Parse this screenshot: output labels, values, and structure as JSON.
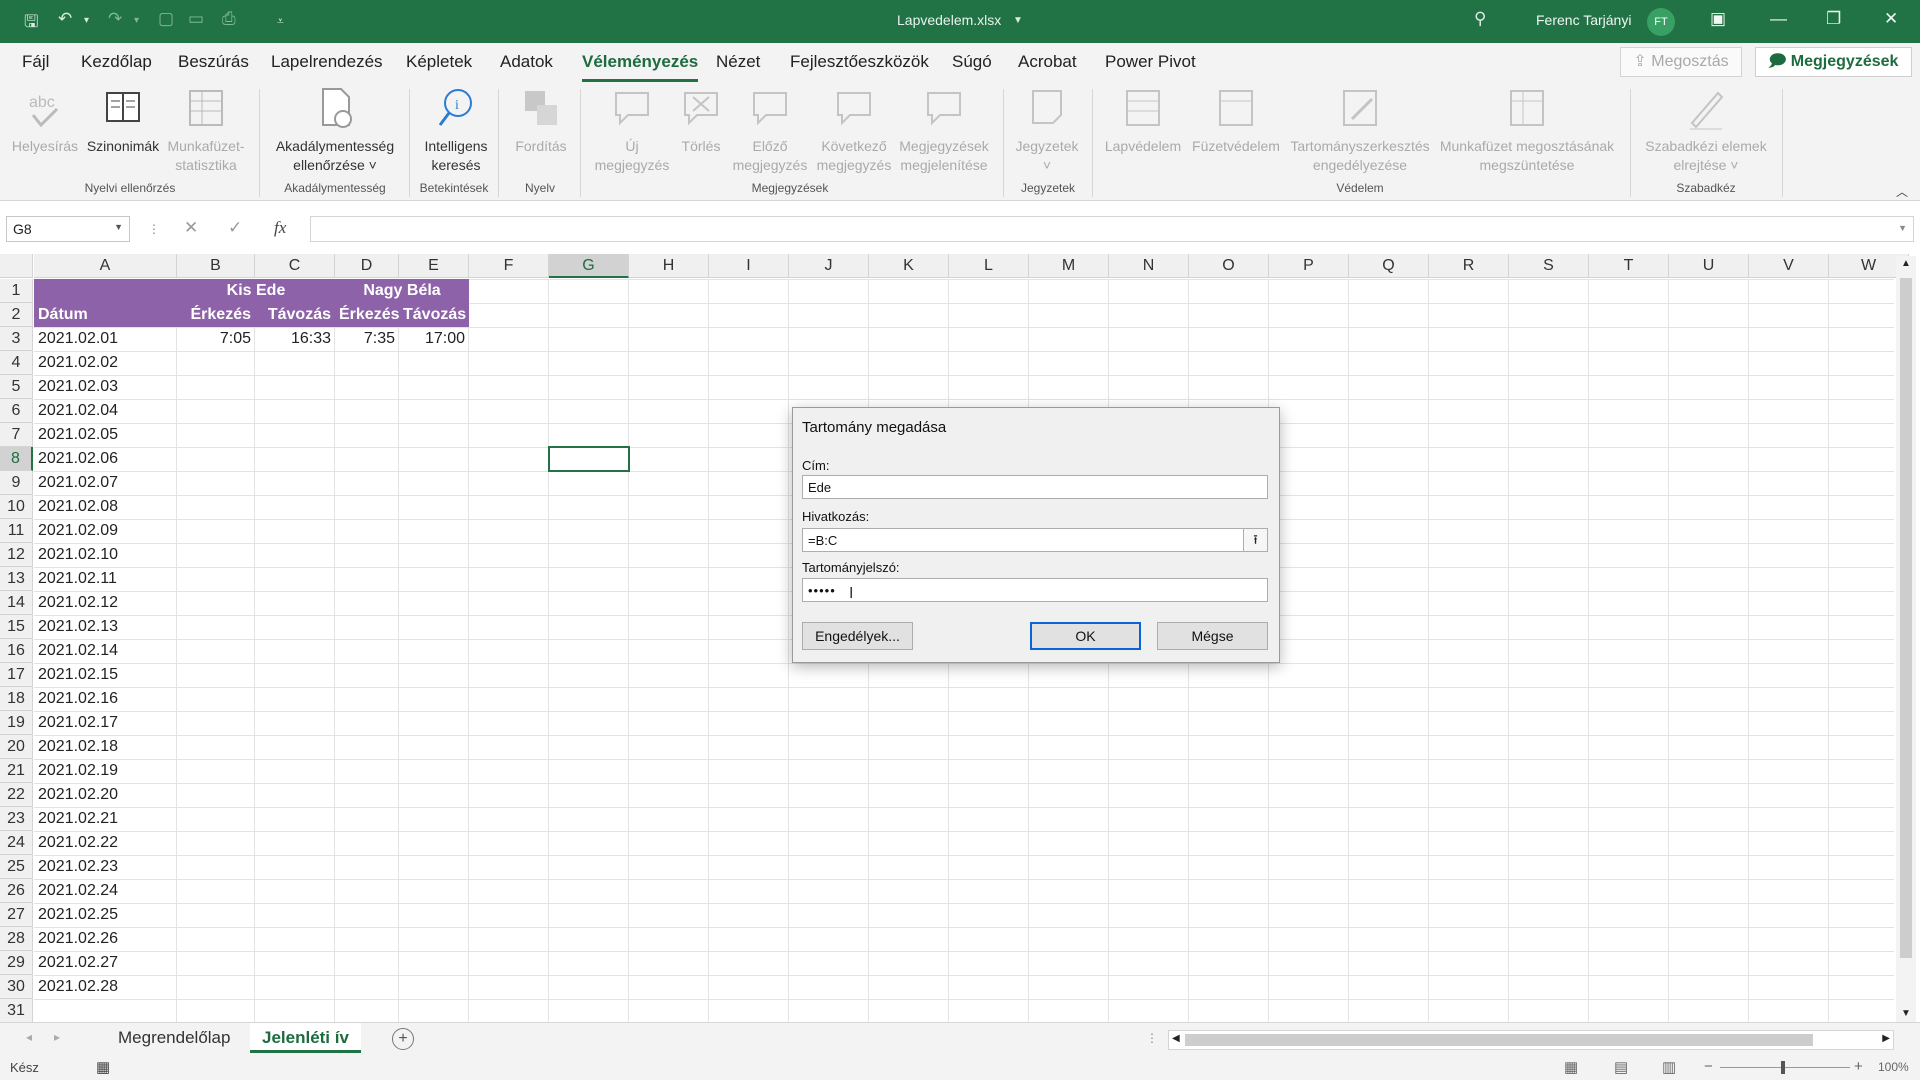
{
  "app": {
    "filename": "Lapvedelem.xlsx",
    "user": "Ferenc Tarjányi",
    "user_initials": "FT"
  },
  "ribbon_tabs": [
    "Fájl",
    "Kezdőlap",
    "Beszúrás",
    "Lapelrendezés",
    "Képletek",
    "Adatok",
    "Véleményezés",
    "Nézet",
    "Fejlesztőeszközök",
    "Súgó",
    "Acrobat",
    "Power Pivot"
  ],
  "active_tab": "Véleményezés",
  "share_label": "Megosztás",
  "comments_label": "Megjegyzések",
  "ribbon": {
    "buttons": {
      "spelling": "Helyesírás",
      "thesaurus": "Szinonimák",
      "workbook_stats_1": "Munkafüzet-",
      "workbook_stats_2": "statisztika",
      "accessibility_1": "Akadálymentesség",
      "accessibility_2": "ellenőrzése ˅",
      "smart_lookup_1": "Intelligens",
      "smart_lookup_2": "keresés",
      "translate": "Fordítás",
      "new_comment_1": "Új",
      "new_comment_2": "megjegyzés",
      "delete": "Törlés",
      "prev_comment_1": "Előző",
      "prev_comment_2": "megjegyzés",
      "next_comment_1": "Következő",
      "next_comment_2": "megjegyzés",
      "show_comments_1": "Megjegyzések",
      "show_comments_2": "megjelenítése",
      "notes": "Jegyzetek",
      "protect_sheet": "Lapvédelem",
      "protect_workbook": "Füzetvédelem",
      "allow_edit_ranges_1": "Tartományszerkesztés",
      "allow_edit_ranges_2": "engedélyezése",
      "unshare_1": "Munkafüzet megosztásának",
      "unshare_2": "megszüntetése",
      "hide_ink_1": "Szabadkézi elemek",
      "hide_ink_2": "elrejtése ˅"
    },
    "groups": {
      "proofing": "Nyelvi ellenőrzés",
      "accessibility": "Akadálymentesség",
      "insights": "Betekintések",
      "language": "Nyelv",
      "comments": "Megjegyzések",
      "notes": "Jegyzetek",
      "protect": "Védelem",
      "ink": "Szabadkéz"
    }
  },
  "formula_bar": {
    "name_box": "G8",
    "formula": "",
    "fx_label": "fx"
  },
  "columns": [
    "A",
    "B",
    "C",
    "D",
    "E",
    "F",
    "G",
    "H",
    "I",
    "J",
    "K",
    "L",
    "M",
    "N",
    "O",
    "P",
    "Q",
    "R",
    "S",
    "T",
    "U",
    "V",
    "W"
  ],
  "rows": [
    "1",
    "2",
    "3",
    "4",
    "5",
    "6",
    "7",
    "8",
    "9",
    "10",
    "11",
    "12",
    "13",
    "14",
    "15",
    "16",
    "17",
    "18",
    "19",
    "20",
    "21",
    "22",
    "23",
    "24",
    "25",
    "26",
    "27",
    "28",
    "29",
    "30",
    "31"
  ],
  "sheet": {
    "header_kis_ede": "Kis Ede",
    "header_nagy_bela": "Nagy Béla",
    "header_datum": "Dátum",
    "sub_headers": [
      "Érkezés",
      "Távozás",
      "Érkezés",
      "Távozás"
    ],
    "row3_values": [
      "7:05",
      "16:33",
      "7:35",
      "17:00"
    ],
    "dates": [
      "2021.02.01",
      "2021.02.02",
      "2021.02.03",
      "2021.02.04",
      "2021.02.05",
      "2021.02.06",
      "2021.02.07",
      "2021.02.08",
      "2021.02.09",
      "2021.02.10",
      "2021.02.11",
      "2021.02.12",
      "2021.02.13",
      "2021.02.14",
      "2021.02.15",
      "2021.02.16",
      "2021.02.17",
      "2021.02.18",
      "2021.02.19",
      "2021.02.20",
      "2021.02.21",
      "2021.02.22",
      "2021.02.23",
      "2021.02.24",
      "2021.02.25",
      "2021.02.26",
      "2021.02.27",
      "2021.02.28"
    ]
  },
  "sheet_tabs": [
    "Megrendelőlap",
    "Jelenléti ív"
  ],
  "active_sheet": "Jelenléti ív",
  "status": {
    "ready": "Kész",
    "zoom": "100%"
  },
  "dialog": {
    "title": "Tartomány megadása",
    "title_label": "Cím:",
    "title_value": "Ede",
    "ref_label": "Hivatkozás:",
    "ref_value": "=B:C",
    "password_label": "Tartományjelszó:",
    "password_value": "•••••",
    "permissions_button": "Engedélyek...",
    "ok_button": "OK",
    "cancel_button": "Mégse"
  }
}
